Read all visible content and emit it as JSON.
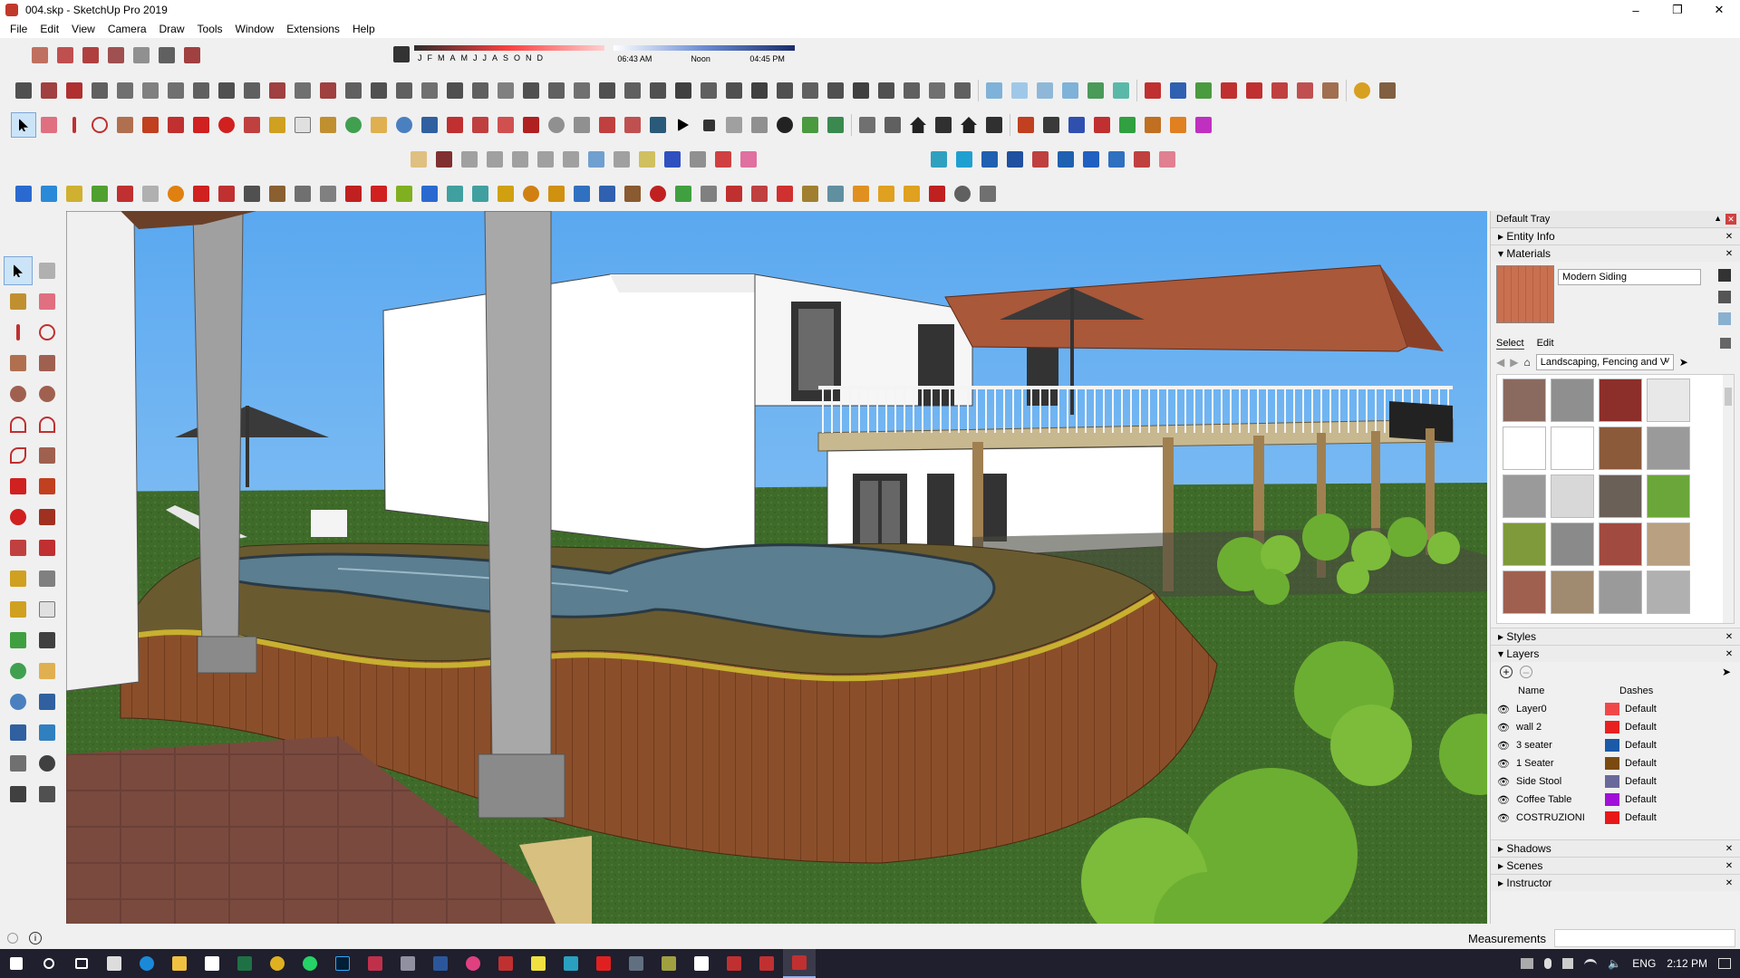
{
  "window": {
    "title": "004.skp - SketchUp Pro 2019",
    "controls": [
      "minimize-icon",
      "maximize-icon",
      "close-icon"
    ]
  },
  "menu": [
    "File",
    "Edit",
    "View",
    "Camera",
    "Draw",
    "Tools",
    "Window",
    "Extensions",
    "Help"
  ],
  "shadows_bar": {
    "months": [
      "J",
      "F",
      "M",
      "A",
      "M",
      "J",
      "J",
      "A",
      "S",
      "O",
      "N",
      "D"
    ],
    "time_start": "06:43 AM",
    "time_mid": "Noon",
    "time_end": "04:45 PM"
  },
  "colors": {
    "sky": "#7db8f0",
    "grass": "#3f6b2a",
    "deck_wood": "#8a4f2a",
    "roof": "#a9583a",
    "water": "#5b7e90",
    "taskbar": "#1f1f2e"
  },
  "tray": {
    "title": "Default Tray",
    "panels": {
      "entity_info": "Entity Info",
      "materials": "Materials",
      "styles": "Styles",
      "layers": "Layers",
      "shadows": "Shadows",
      "scenes": "Scenes",
      "instructor": "Instructor"
    },
    "materials": {
      "current_name": "Modern Siding",
      "tab_select": "Select",
      "tab_edit": "Edit",
      "library": "Landscaping, Fencing and V",
      "swatches": [
        "#8a6a5e",
        "#8f8f8f",
        "#8c2e2a",
        "#e8e8e8",
        "#ffffff",
        "#ffffff",
        "#8a5a3a",
        "#9a9a9a",
        "#9a9a9a",
        "#d8d8d8",
        "#6a6058",
        "#6aa63a",
        "#7f9a3a",
        "#8a8a8a",
        "#a04a40",
        "#b8a080",
        "#a06050",
        "#a08a70",
        "#9a9a9a",
        "#b0b0b0"
      ]
    },
    "layers": {
      "col_name": "Name",
      "col_dashes": "Dashes",
      "rows": [
        {
          "name": "Layer0",
          "color": "#f04848",
          "dashes": "Default"
        },
        {
          "name": "wall 2",
          "color": "#e82020",
          "dashes": "Default"
        },
        {
          "name": "3 seater",
          "color": "#1a5aa8",
          "dashes": "Default"
        },
        {
          "name": "1 Seater",
          "color": "#7a4a10",
          "dashes": "Default"
        },
        {
          "name": "Side Stool",
          "color": "#6a6a9a",
          "dashes": "Default"
        },
        {
          "name": "Coffee Table",
          "color": "#a010d8",
          "dashes": "Default"
        },
        {
          "name": "COSTRUZIONI",
          "color": "#e81818",
          "dashes": "Default"
        }
      ]
    }
  },
  "status": {
    "measurements_label": "Measurements"
  },
  "taskbar": {
    "lang": "ENG",
    "time": "2:12 PM"
  }
}
